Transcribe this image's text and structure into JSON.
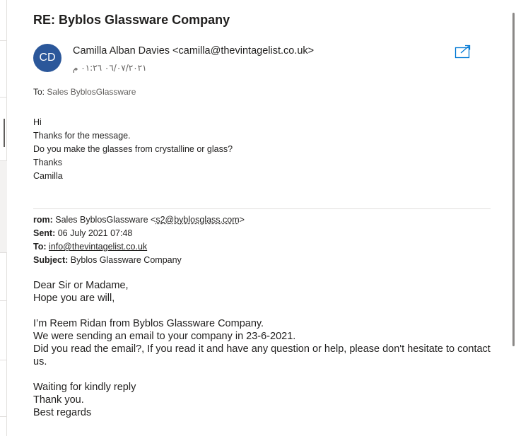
{
  "email": {
    "subject": "RE: Byblos Glassware Company",
    "avatar_initials": "CD",
    "sender": "Camilla Alban Davies <camilla@thevintagelist.co.uk>",
    "date": "٠٦/٠٧/٢٠٢١ ٠١:٢٦ م",
    "to_label": "To:",
    "to_recipients": "Sales ByblosGlassware",
    "reply_lines": [
      "Hi",
      "Thanks for the message.",
      "Do you make the glasses from crystalline or glass?",
      "Thanks",
      "Camilla"
    ]
  },
  "quoted": {
    "from_label": "rom:",
    "from_name": "Sales ByblosGlassware <",
    "from_email": "s2@byblosglass.com",
    "from_close": ">",
    "sent_label": "Sent:",
    "sent_value": "06 July 2021 07:48",
    "to_label": "To:",
    "to_value": "info@thevintagelist.co.uk",
    "subject_label": "Subject:",
    "subject_value": "Byblos Glassware Company",
    "body": {
      "line1": "Dear Sir or Madame,",
      "line2": "Hope you are will,",
      "line3": "I’m Reem Ridan from Byblos Glassware Company.",
      "line4": "We were sending an email to your company in 23-6-2021.",
      "line5": "Did you read the email?, If you read it and have any question or help, please don't hesitate to contact us.",
      "line6": "Waiting for kindly reply",
      "line7": "Thank you.",
      "line8": "Best regards"
    }
  },
  "colors": {
    "avatar_bg": "#2b579a",
    "accent": "#0078d4",
    "text": "#201f1e",
    "secondary_text": "#605e5c"
  },
  "icons": {
    "popout": "open-in-new-window-icon"
  }
}
